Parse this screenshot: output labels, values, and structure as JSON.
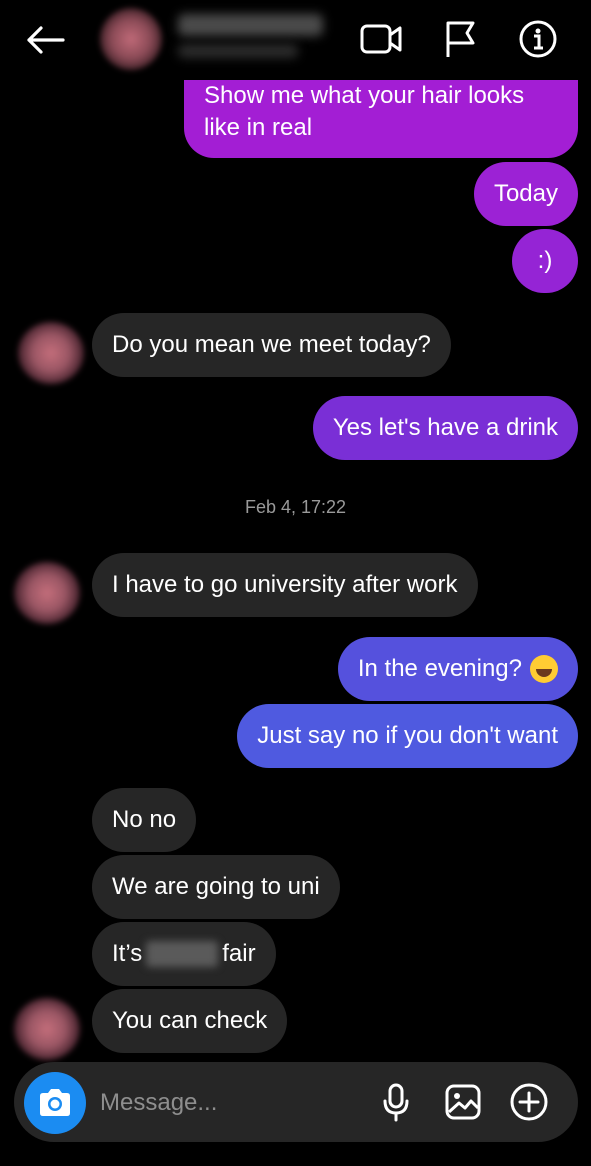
{
  "header": {
    "back_icon": "arrow-left-icon",
    "video_icon": "video-camera-icon",
    "flag_icon": "flag-icon",
    "info_icon": "info-icon"
  },
  "colors": {
    "background": "#000000",
    "incoming_bubble": "#262626",
    "outgoing_purple": "#a31ed4",
    "outgoing_violet": "#7a2fd6",
    "outgoing_blue": "#4f5ae0",
    "camera_button": "#1b8cf2",
    "timestamp_text": "#9a9a9a"
  },
  "messages": [
    {
      "id": "m1",
      "side": "out",
      "text": "Show me what your hair looks like in real"
    },
    {
      "id": "m2",
      "side": "out",
      "text": "Today"
    },
    {
      "id": "m3",
      "side": "out",
      "text": ":)"
    },
    {
      "id": "m4",
      "side": "in",
      "text": "Do you mean we meet today?"
    },
    {
      "id": "m5",
      "side": "out",
      "text": "Yes let's have a drink"
    },
    {
      "id": "m6",
      "side": "in",
      "text": "I have to go university after work"
    },
    {
      "id": "m7",
      "side": "out",
      "text": "In the evening?",
      "emoji": "laughing-tears-emoji"
    },
    {
      "id": "m8",
      "side": "out",
      "text": "Just say no if you don't want"
    },
    {
      "id": "m9",
      "side": "in",
      "text": "No no"
    },
    {
      "id": "m10",
      "side": "in",
      "text": "We are going to uni"
    },
    {
      "id": "m11",
      "side": "in",
      "text_before": "It’s",
      "text_after": "fair",
      "redacted": true
    },
    {
      "id": "m12",
      "side": "in",
      "text": "You can check"
    }
  ],
  "timestamp": "Feb 4, 17:22",
  "composer": {
    "placeholder": "Message...",
    "camera_icon": "camera-icon",
    "mic_icon": "microphone-icon",
    "gallery_icon": "image-gallery-icon",
    "plus_icon": "plus-circle-icon"
  }
}
